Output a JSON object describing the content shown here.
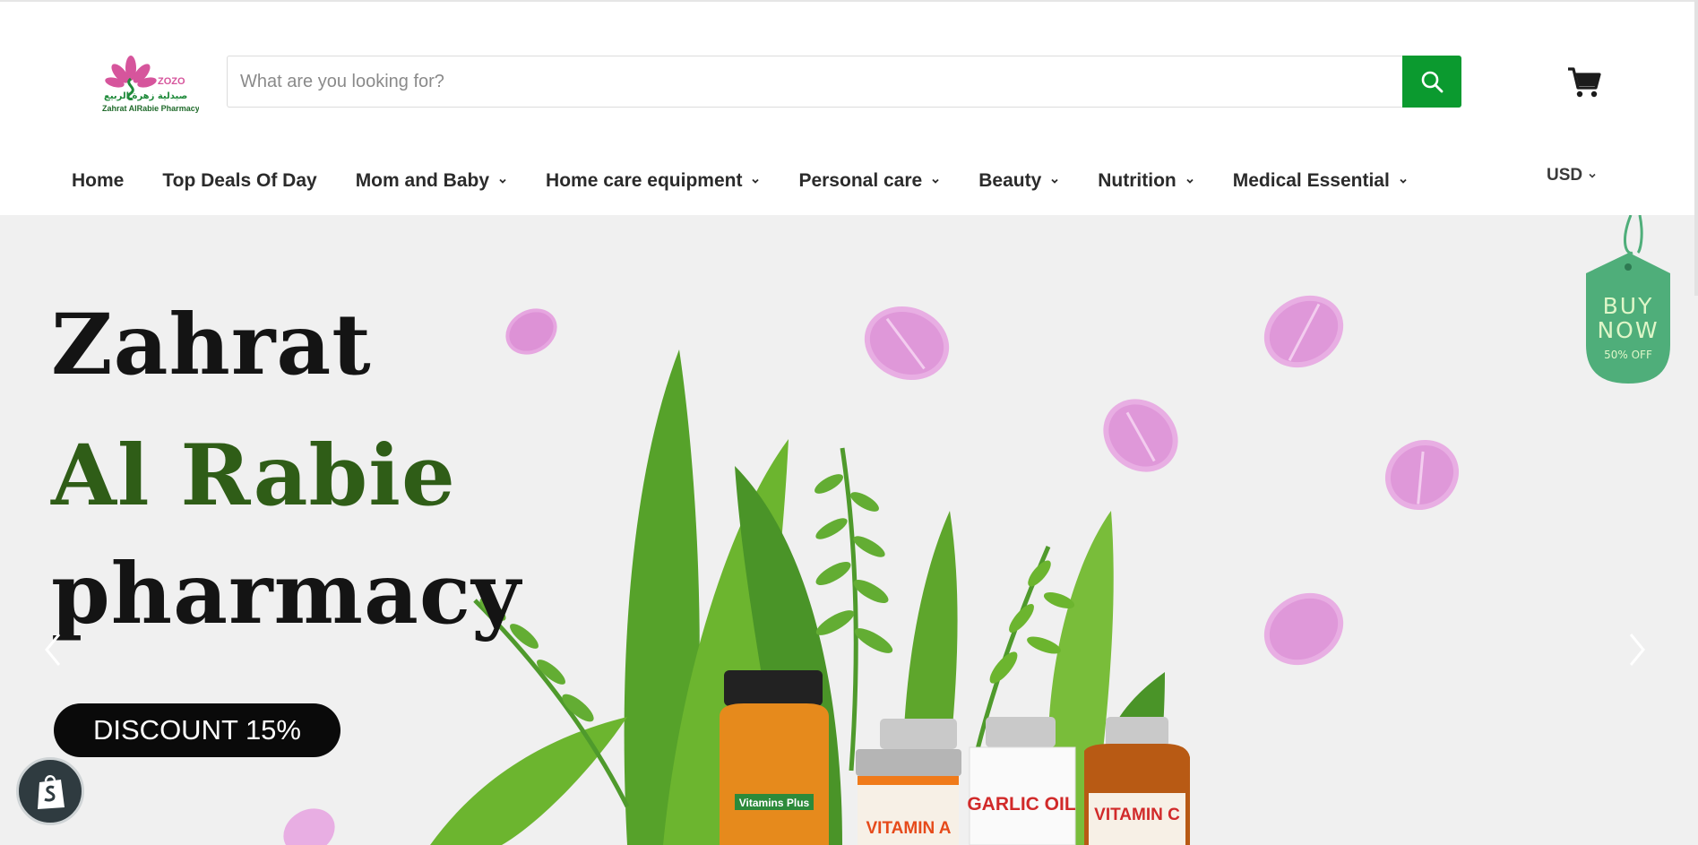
{
  "logo": {
    "brand_short": "ZOZO",
    "arabic_name": "صيدلية زهرة الربيع",
    "english_name": "Zahrat AlRabie Pharmacy"
  },
  "search": {
    "placeholder": "What are you looking for?"
  },
  "nav": {
    "items": [
      {
        "label": "Home",
        "has_dropdown": false
      },
      {
        "label": "Top Deals Of Day",
        "has_dropdown": false
      },
      {
        "label": "Mom and Baby",
        "has_dropdown": true
      },
      {
        "label": "Home care equipment",
        "has_dropdown": true
      },
      {
        "label": "Personal care",
        "has_dropdown": true
      },
      {
        "label": "Beauty",
        "has_dropdown": true
      },
      {
        "label": "Nutrition",
        "has_dropdown": true
      },
      {
        "label": "Medical Essential",
        "has_dropdown": true
      }
    ],
    "currency": "USD"
  },
  "hero": {
    "line1": "Zahrat",
    "line2": "Al Rabie",
    "line3": "pharmacy",
    "discount_label": "DISCOUNT 15%",
    "tag": {
      "line1": "BUY",
      "line2": "NOW",
      "line3": "50% OFF"
    },
    "bottles": [
      {
        "label": "Vitamins Plus",
        "color": "#e68a1c"
      },
      {
        "label": "VITAMIN A",
        "color": "#f07a1a"
      },
      {
        "label": "GARLIC OIL",
        "color": "#ffffff"
      },
      {
        "label": "VITAMIN C",
        "color": "#b85a14"
      }
    ]
  },
  "colors": {
    "accent_green": "#0b9a2f",
    "title_green": "#2f5d17",
    "tag_green": "#4fae7a",
    "pill_pink": "#e6a6e0"
  },
  "icons": {
    "search": "search-icon",
    "cart": "cart-icon",
    "chevron": "chevron-down-icon",
    "prev": "chevron-left-icon",
    "next": "chevron-right-icon",
    "shopify": "shopify-bag-icon"
  }
}
